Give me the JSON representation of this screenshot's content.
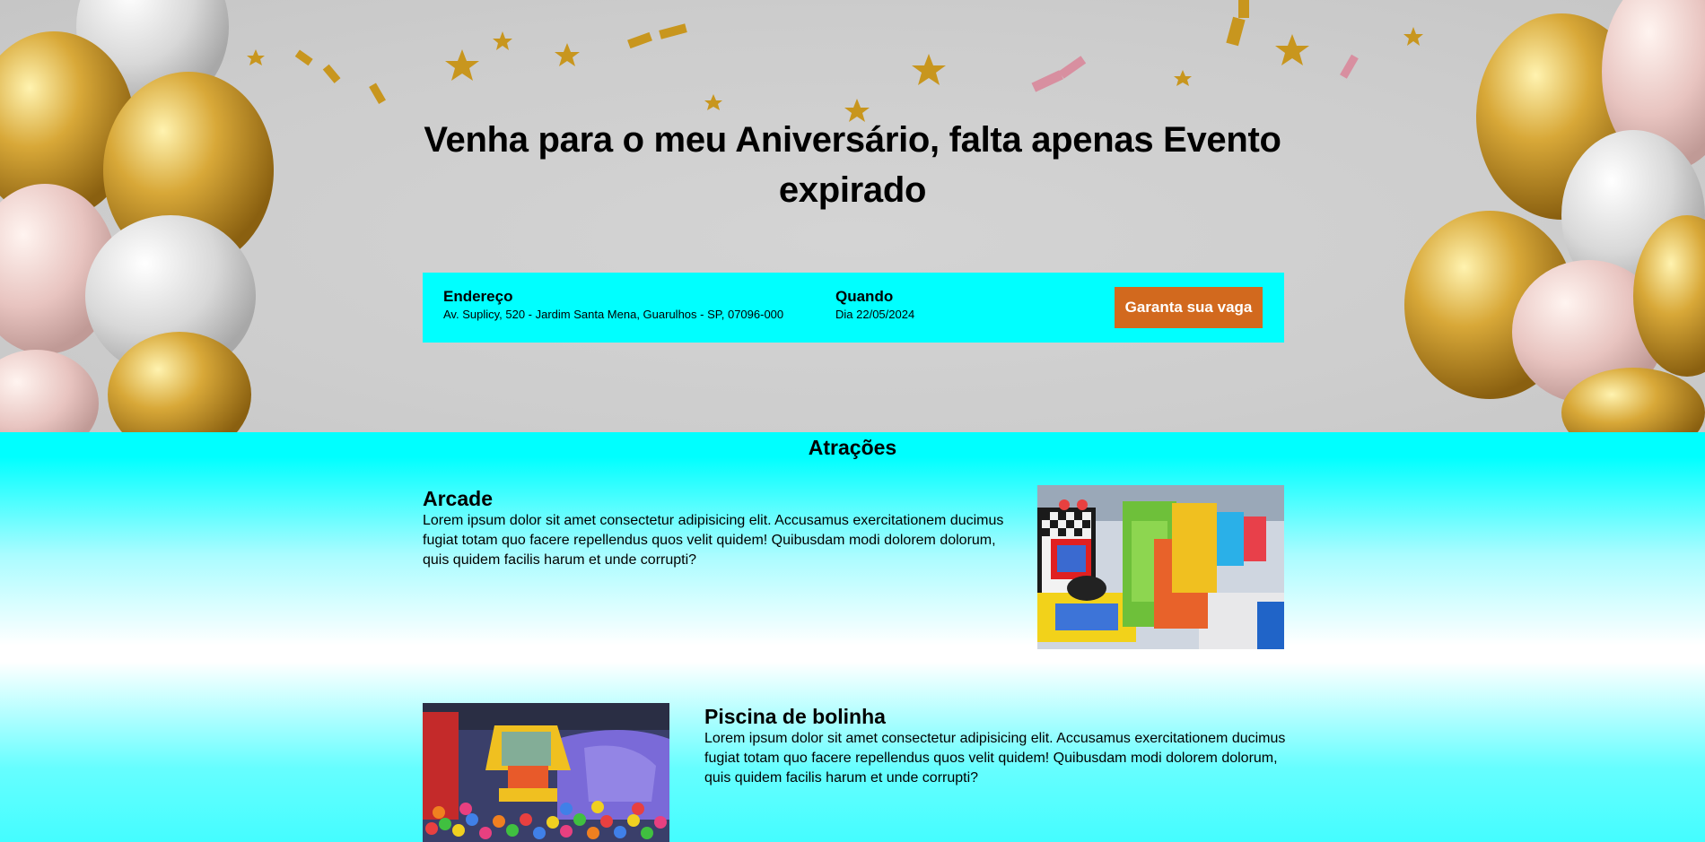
{
  "hero": {
    "title": "Venha para o meu Aniversário, falta apenas Evento expirado"
  },
  "info": {
    "address_label": "Endereço",
    "address_value": "Av. Suplicy, 520 - Jardim Santa Mena, Guarulhos - SP, 07096-000",
    "when_label": "Quando",
    "when_value": "Dia 22/05/2024",
    "cta_label": "Garanta sua vaga"
  },
  "attractions": {
    "title": "Atrações",
    "items": [
      {
        "name": "Arcade",
        "description": "Lorem ipsum dolor sit amet consectetur adipisicing elit. Accusamus exercitationem ducimus fugiat totam quo facere repellendus quos velit quidem! Quibusdam modi dolorem dolorum, quis quidem facilis harum et unde corrupti?"
      },
      {
        "name": "Piscina de bolinha",
        "description": "Lorem ipsum dolor sit amet consectetur adipisicing elit. Accusamus exercitationem ducimus fugiat totam quo facere repellendus quos velit quidem! Quibusdam modi dolorem dolorum, quis quidem facilis harum et unde corrupti?"
      }
    ]
  },
  "colors": {
    "accent_cyan": "#00ffff",
    "cta_orange": "#d2691e"
  }
}
